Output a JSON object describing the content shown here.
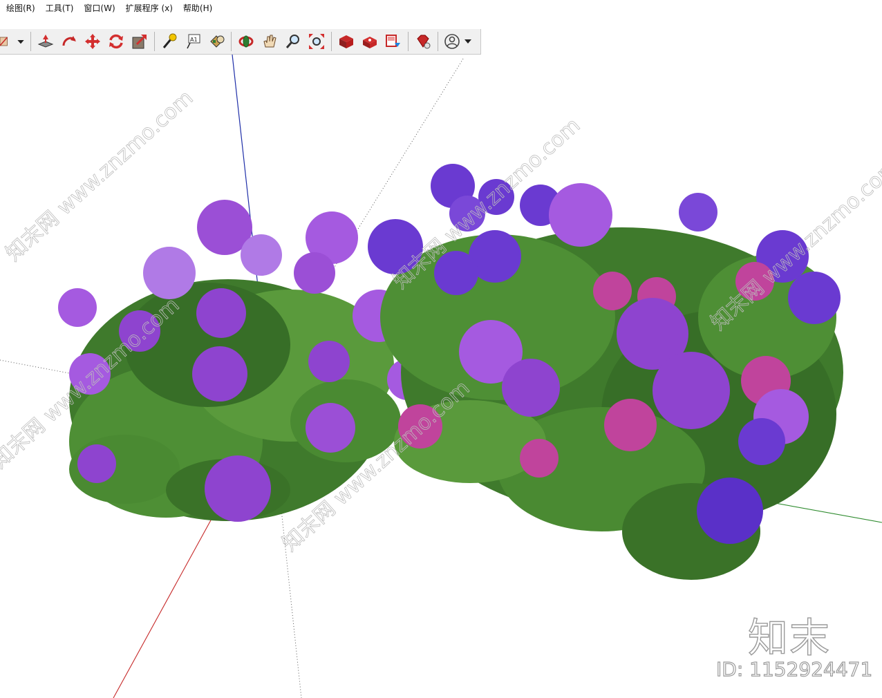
{
  "menubar": {
    "items": [
      "绘图(R)",
      "工具(T)",
      "窗口(W)",
      "扩展程序 (x)",
      "帮助(H)"
    ]
  },
  "toolbar": {
    "tools": [
      "select-tool-icon",
      "dropdown-arrow-icon",
      "push-pull-icon",
      "follow-me-icon",
      "move-icon",
      "rotate-icon",
      "scale-icon",
      "tape-measure-icon",
      "text-icon",
      "paint-bucket-icon",
      "orbit-icon",
      "pan-icon",
      "zoom-icon",
      "zoom-extents-icon",
      "3d-warehouse-icon",
      "extension-warehouse-icon",
      "send-to-layout-icon",
      "ruby-console-icon",
      "account-icon"
    ]
  },
  "viewport": {
    "background": "#ffffff",
    "axes": {
      "red": "#c62828",
      "green": "#2e8b2e",
      "blue": "#1e2ea8"
    }
  },
  "watermark": {
    "logo_text": "知末",
    "id_text": "ID: 1152924471",
    "diagonal_text": "知末网 www.znzmo.com"
  }
}
